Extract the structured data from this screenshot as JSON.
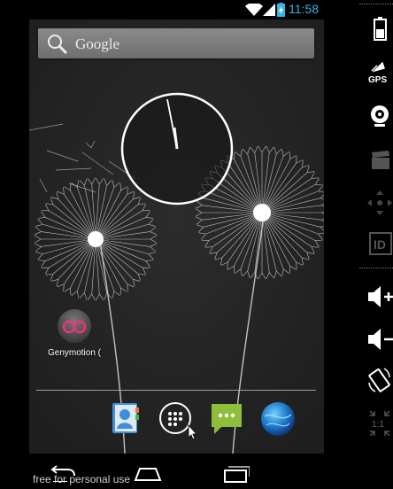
{
  "status_bar": {
    "time": "11:58",
    "icons": [
      "wifi-icon",
      "signal-icon",
      "battery-charging-icon"
    ]
  },
  "search": {
    "label": "Google"
  },
  "apps": [
    {
      "label": "Genymotion (",
      "icon": "genymotion-icon"
    }
  ],
  "dock": [
    {
      "name": "contacts",
      "icon": "contacts-icon"
    },
    {
      "name": "all-apps",
      "icon": "app-drawer-icon"
    },
    {
      "name": "messaging",
      "icon": "messaging-icon"
    },
    {
      "name": "browser",
      "icon": "browser-globe-icon"
    }
  ],
  "navbar": {
    "icons": [
      "back-icon",
      "home-icon",
      "recent-apps-icon"
    ]
  },
  "watermark": {
    "text": "free for personal use"
  },
  "side_panel": {
    "icons": [
      "battery-icon",
      "gps-icon",
      "camera-icon",
      "video-capture-icon",
      "dpad-icon",
      "device-id-icon",
      "volume-up-icon",
      "volume-down-icon",
      "rotate-icon",
      "pixel-perfect-icon"
    ],
    "gps_label": "GPS",
    "id_label": "ID",
    "scale_label": "1:1"
  },
  "colors": {
    "accent": "#33b5e5",
    "screen_bg": "#262626",
    "messaging": "#8fbe3a"
  }
}
